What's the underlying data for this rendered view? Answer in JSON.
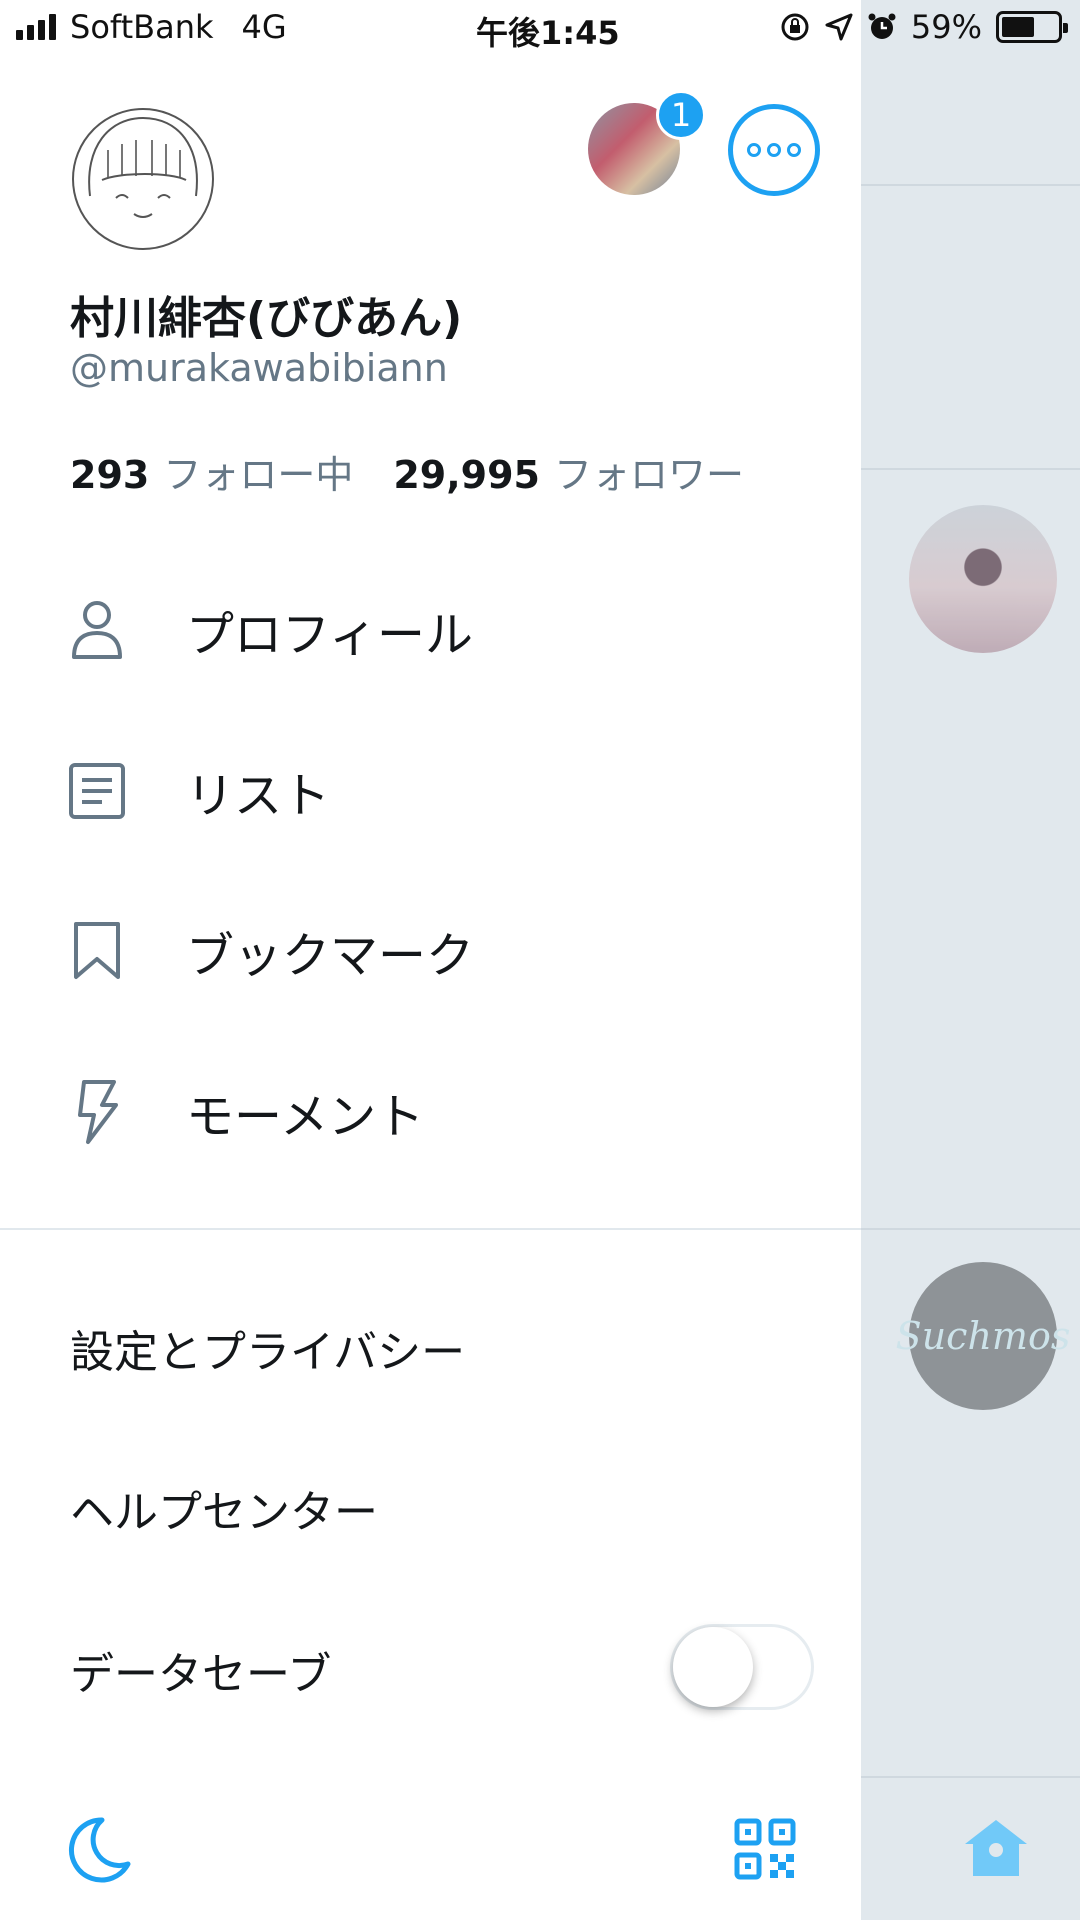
{
  "status_bar": {
    "carrier": "SoftBank",
    "network": "4G",
    "time": "午後1:45",
    "battery_percent": "59%",
    "battery_level": 0.59
  },
  "profile": {
    "name": "村川緋杏(びびあん)",
    "handle": "@murakawabibiann",
    "following_count": "293",
    "following_label": "フォロー中",
    "followers_count": "29,995",
    "followers_label": "フォロワー",
    "other_account_badge": "1"
  },
  "menu": {
    "items": [
      {
        "label": "プロフィール",
        "icon": "person-icon"
      },
      {
        "label": "リスト",
        "icon": "list-icon"
      },
      {
        "label": "ブックマーク",
        "icon": "bookmark-icon"
      },
      {
        "label": "モーメント",
        "icon": "lightning-icon"
      }
    ]
  },
  "settings": {
    "privacy_label": "設定とプライバシー",
    "help_label": "ヘルプセンター",
    "data_saver_label": "データセーブ",
    "data_saver_on": false
  },
  "timeline": {
    "brand_avatar_text": "Suchmos"
  },
  "colors": {
    "accent": "#1da1f2",
    "secondary_text": "#657786",
    "timeline_bg": "#e1e8ed",
    "home_icon": "#71c9f8"
  }
}
